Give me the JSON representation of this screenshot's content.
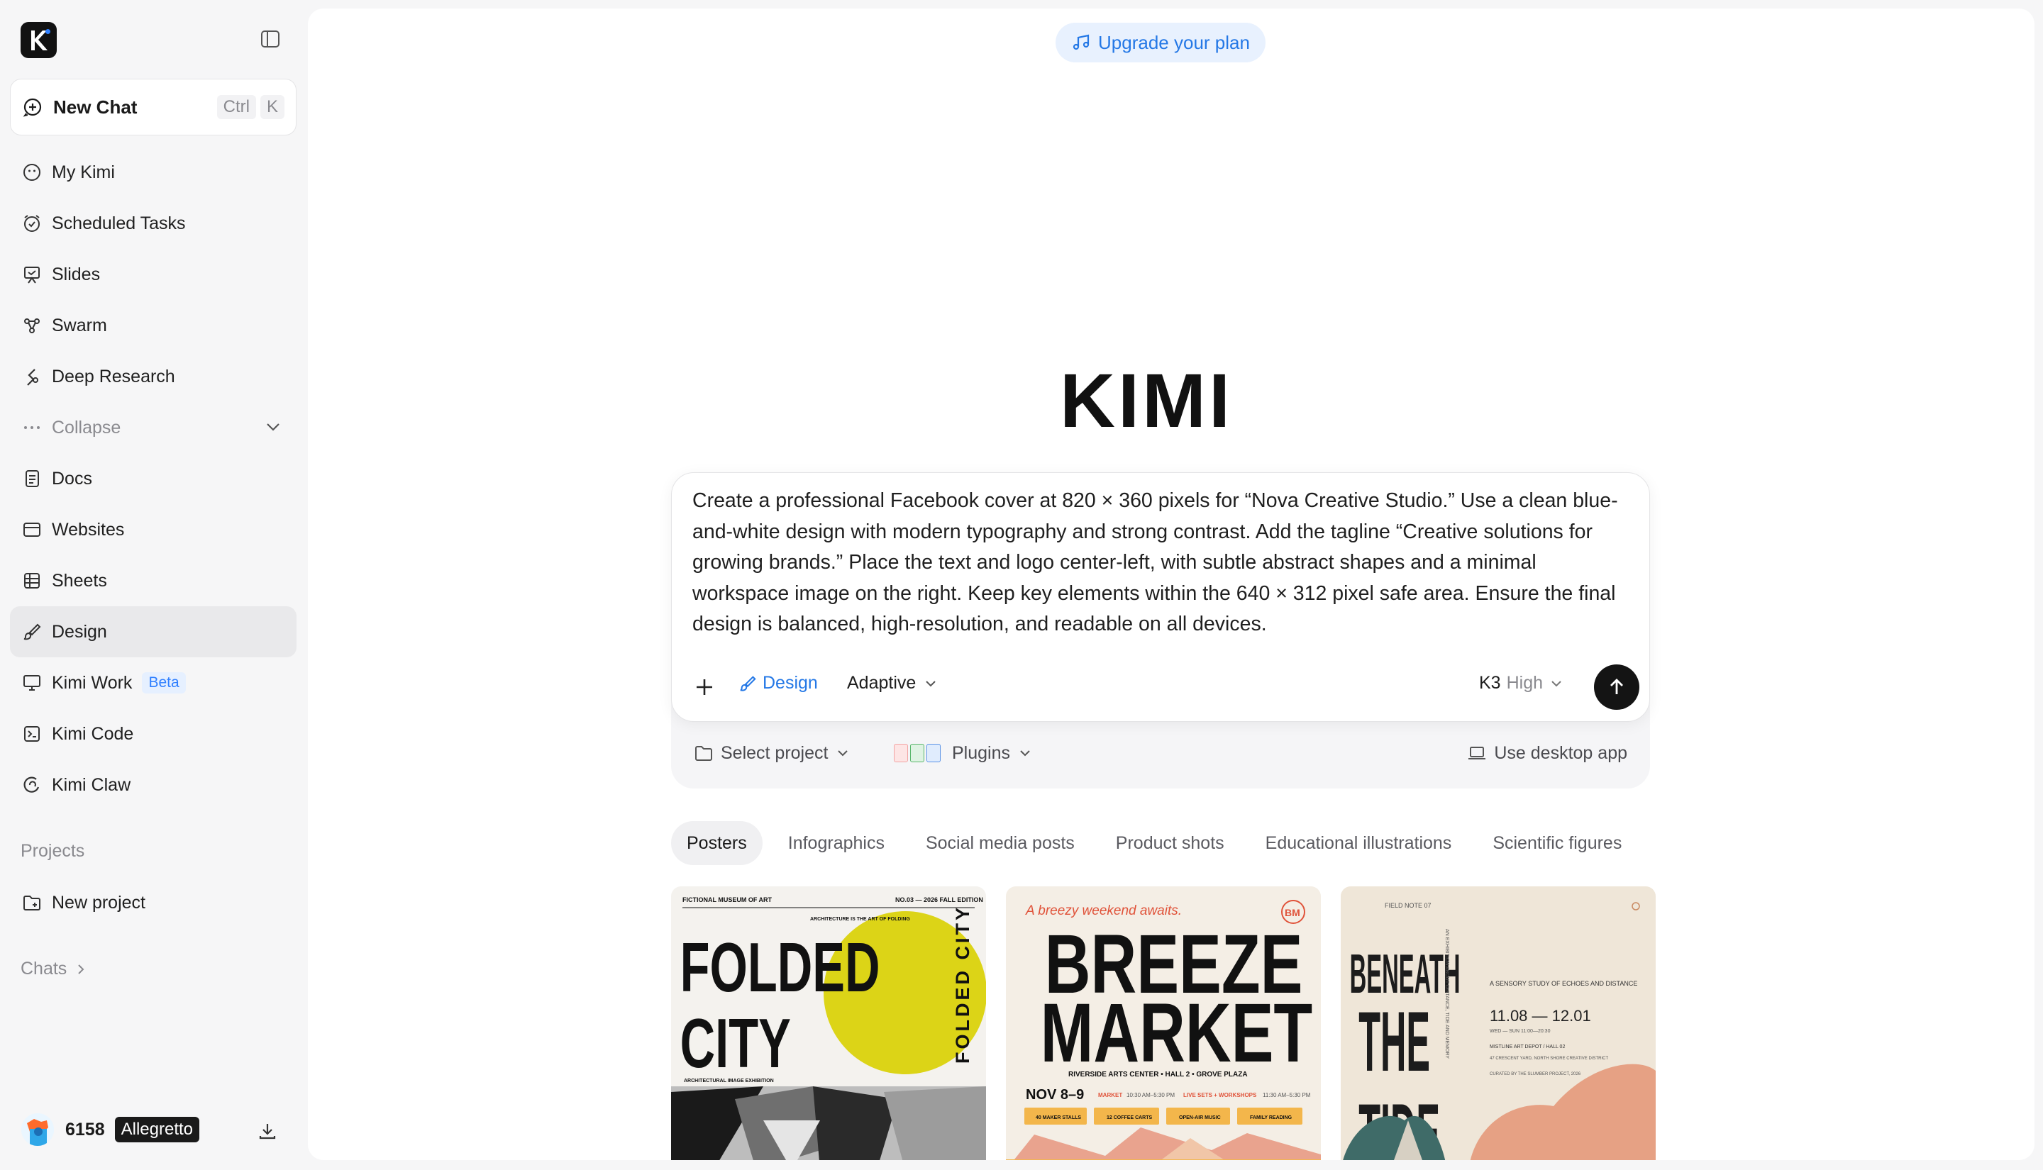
{
  "sidebar": {
    "new_chat": {
      "label": "New Chat",
      "kbd": [
        "Ctrl",
        "K"
      ]
    },
    "items": [
      {
        "label": "My Kimi",
        "icon": "smile-icon"
      },
      {
        "label": "Scheduled Tasks",
        "icon": "alarm-clock-icon"
      },
      {
        "label": "Slides",
        "icon": "presentation-icon"
      },
      {
        "label": "Swarm",
        "icon": "swarm-icon"
      },
      {
        "label": "Deep Research",
        "icon": "research-icon"
      },
      {
        "label": "Collapse",
        "icon": "more-dots-icon"
      },
      {
        "label": "Docs",
        "icon": "doc-icon"
      },
      {
        "label": "Websites",
        "icon": "browser-icon"
      },
      {
        "label": "Sheets",
        "icon": "table-icon"
      },
      {
        "label": "Design",
        "icon": "brush-icon"
      },
      {
        "label": "Kimi Work",
        "icon": "monitor-icon",
        "badge": "Beta"
      },
      {
        "label": "Kimi Code",
        "icon": "terminal-icon"
      },
      {
        "label": "Kimi Claw",
        "icon": "claw-icon"
      }
    ],
    "projects_label": "Projects",
    "new_project": "New project",
    "chats_label": "Chats",
    "user": {
      "count": "6158",
      "plan": "Allegretto"
    }
  },
  "header": {
    "upgrade_label": "Upgrade your plan"
  },
  "brand": {
    "wordmark": "KIMI"
  },
  "prompt": {
    "text": "Create a professional Facebook cover at 820 × 360 pixels for “Nova Creative Studio.” Use a clean blue-and-white design with modern typography and strong contrast. Add the tagline “Creative solutions for growing brands.” Place the text and logo center-left, with subtle abstract shapes and a minimal workspace image on the right. Keep key elements within the 640 × 312 pixel safe area. Ensure the final design is balanced, high-resolution, and readable on all devices.",
    "mode_tag": "Design",
    "mode_select": "Adaptive",
    "model": "K3",
    "effort": "High"
  },
  "under": {
    "select_project": "Select project",
    "plugins": "Plugins",
    "desktop": "Use desktop app"
  },
  "tabs": [
    "Posters",
    "Infographics",
    "Social media posts",
    "Product shots",
    "Educational illustrations",
    "Scientific figures"
  ],
  "cards": {
    "folded": {
      "museum": "FICTIONAL MUSEUM OF ART",
      "edition": "NO.03 — 2026 FALL EDITION",
      "tag": "ARCHITECTURE IS THE ART OF FOLDING",
      "title1": "FOLDED",
      "title2": "CITY",
      "vertical": "FOLDED CITY",
      "sub": "ARCHITECTURAL IMAGE EXHIBITION"
    },
    "breeze": {
      "tagline": "A breezy weekend awaits.",
      "logo": "BM",
      "title1": "BREEZE",
      "title2": "MARKET",
      "venue": "RIVERSIDE ARTS CENTER • HALL 2 • GROVE PLAZA",
      "date": "NOV 8–9",
      "market_label": "MARKET",
      "market_time": "10:30 AM–5:30 PM",
      "live_label": "LIVE SETS + WORKSHOPS",
      "live_time": "11:30 AM–5:30 PM",
      "chips": [
        "40 MAKER STALLS",
        "12 COFFEE CARTS",
        "OPEN-AIR MUSIC",
        "FAMILY READING"
      ]
    },
    "tide": {
      "note": "FIELD NOTE 07",
      "title": [
        "BENEATH",
        "THE",
        "TIDE"
      ],
      "side": "AN EXHIBITION ABOUT DISTANCE, TIDE AND MEMORY",
      "desc": "A SENSORY STUDY OF ECHOES AND DISTANCE",
      "dates": "11.08 — 12.01",
      "days": "WED — SUN 11:00—20:30",
      "venue": "MISTLINE ART DEPOT / HALL 02",
      "addr": "47 CRESCENT YARD, NORTH SHORE CREATIVE DISTRICT",
      "curated": "CURATED BY THE SLUMBER PROJECT, 2026"
    }
  },
  "colors": {
    "accent": "#2478e6",
    "send": "#141414",
    "yellow": "#dcd417",
    "breeze_bg": "#f4eee5",
    "tide_bg": "#efe6d8"
  }
}
